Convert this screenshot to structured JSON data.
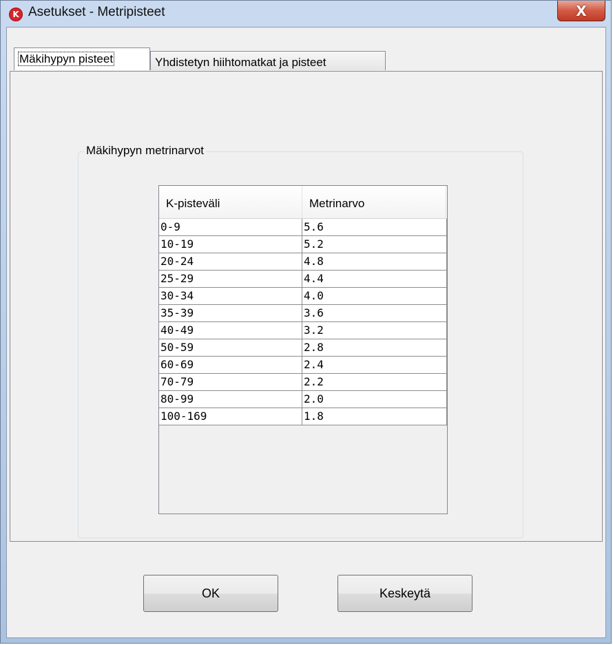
{
  "window": {
    "title": "Asetukset - Metripisteet",
    "app_icon_letter": "K",
    "close_glyph": "X"
  },
  "tabs": [
    {
      "label": "Mäkihypyn pisteet",
      "active": true
    },
    {
      "label": "Yhdistetyn hiihtomatkat ja pisteet",
      "active": false
    }
  ],
  "group": {
    "title": "Mäkihypyn metrinarvot"
  },
  "table": {
    "columns": [
      "K-pisteväli",
      "Metrinarvo"
    ],
    "rows": [
      [
        "0-9",
        "5.6"
      ],
      [
        "10-19",
        "5.2"
      ],
      [
        "20-24",
        "4.8"
      ],
      [
        "25-29",
        "4.4"
      ],
      [
        "30-34",
        "4.0"
      ],
      [
        "35-39",
        "3.6"
      ],
      [
        "40-49",
        "3.2"
      ],
      [
        "50-59",
        "2.8"
      ],
      [
        "60-69",
        "2.4"
      ],
      [
        "70-79",
        "2.2"
      ],
      [
        "80-99",
        "2.0"
      ],
      [
        "100-169",
        "1.8"
      ]
    ]
  },
  "buttons": {
    "ok": "OK",
    "cancel": "Keskeytä"
  }
}
